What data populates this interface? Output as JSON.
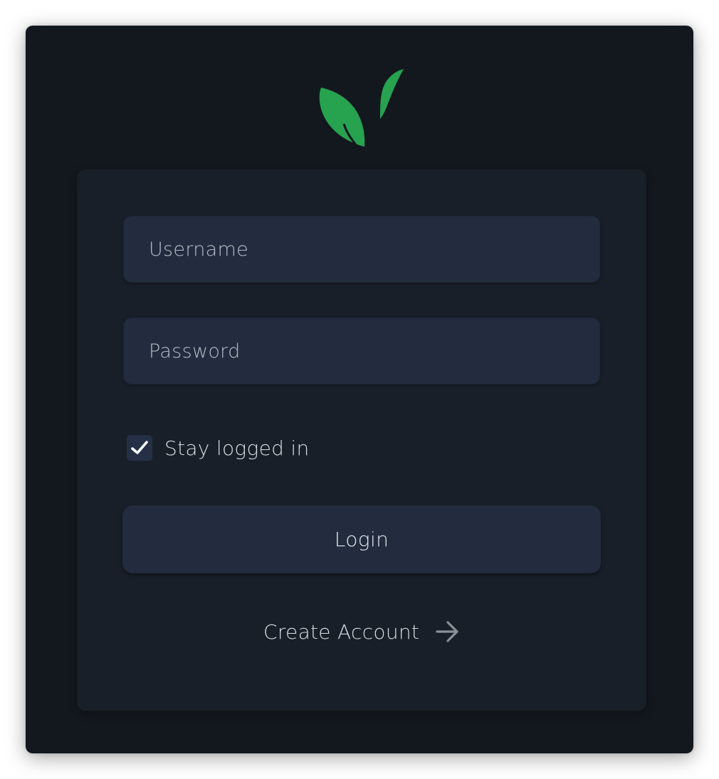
{
  "login": {
    "username_placeholder": "Username",
    "password_placeholder": "Password",
    "stay_logged_in_label": "Stay logged in",
    "stay_logged_in_checked": true,
    "login_button_label": "Login",
    "create_account_label": "Create Account"
  },
  "icons": {
    "logo": "leaf-logo-icon",
    "checkbox": "checkmark-icon",
    "create_account": "arrow-right-icon"
  },
  "colors": {
    "window_background": "#13171e",
    "card_background": "#191f28",
    "input_background": "#222c3e",
    "brand_green": "#27a24f",
    "text_light": "#d8dce3",
    "arrow_gray": "#8a8f98"
  }
}
